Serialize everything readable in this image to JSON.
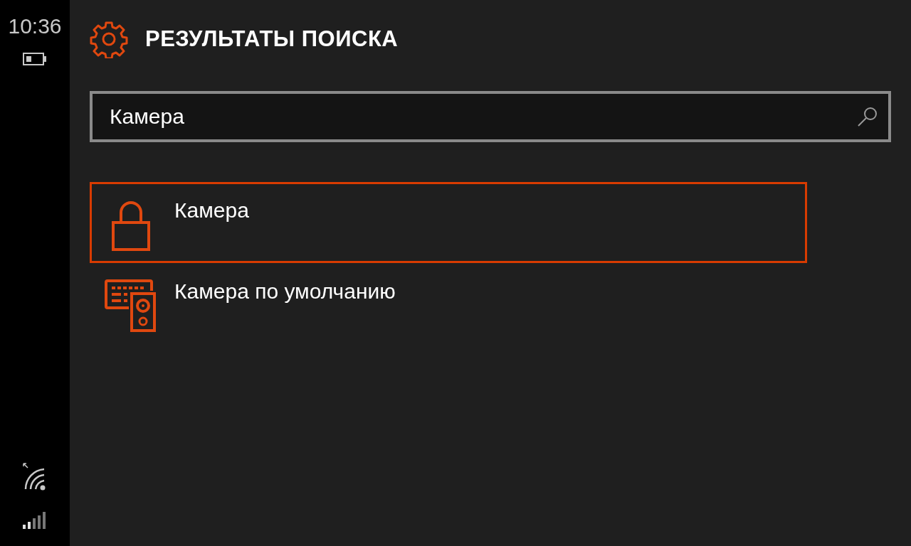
{
  "status_bar": {
    "time": "10:36"
  },
  "header": {
    "title": "РЕЗУЛЬТАТЫ ПОИСКА"
  },
  "search": {
    "value": "Камера"
  },
  "results": [
    {
      "label": "Камера",
      "kind": "lock",
      "selected": true
    },
    {
      "label": "Камера по умолчанию",
      "kind": "devices",
      "selected": false
    }
  ]
}
